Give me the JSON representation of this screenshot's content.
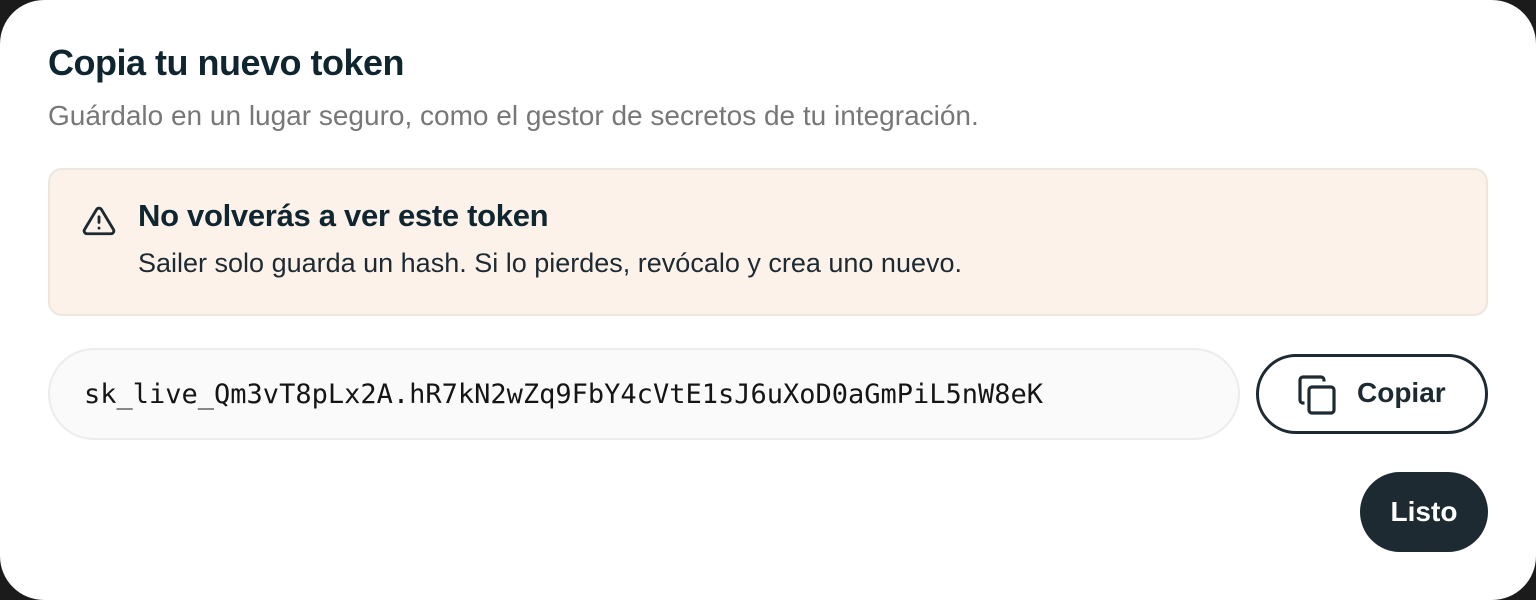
{
  "dialog": {
    "title": "Copia tu nuevo token",
    "subtitle": "Guárdalo en un lugar seguro, como el gestor de secretos de tu integración."
  },
  "warning": {
    "icon": "warning-triangle-icon",
    "title": "No volverás a ver este token",
    "body": "Sailer solo guarda un hash. Si lo pierdes, revócalo y crea uno nuevo."
  },
  "token": {
    "value": "sk_live_Qm3vT8pLx2A.hR7kN2wZq9FbY4cVtE1sJ6uXoD0aGmPiL5nW8eK"
  },
  "actions": {
    "copy_icon": "copy-icon",
    "copy_label": "Copiar",
    "done_label": "Listo"
  },
  "colors": {
    "warning_background": "#fdf2ea",
    "primary_dark": "#1e2a31",
    "title_text": "#0f2530",
    "subtitle_text": "#777777"
  }
}
